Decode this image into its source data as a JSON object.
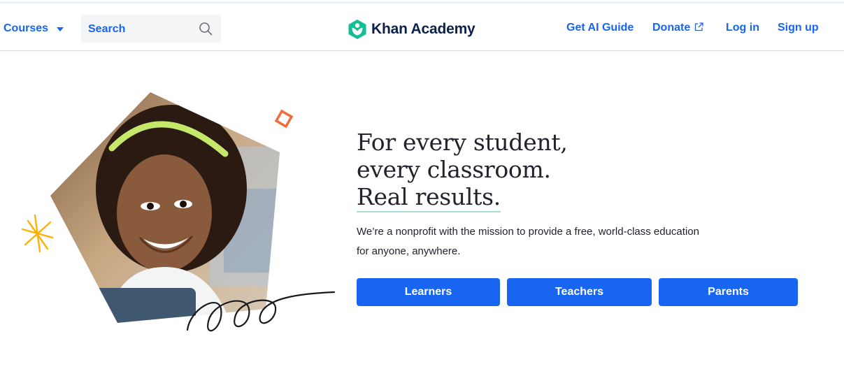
{
  "header": {
    "courses_label": "Courses",
    "search_placeholder": "Search",
    "logo_text": "Khan Academy",
    "links": {
      "ai_guide": "Get AI Guide",
      "donate": "Donate",
      "login": "Log in",
      "signup": "Sign up"
    }
  },
  "hero": {
    "headline_line1": "For every student,",
    "headline_line2": "every classroom.",
    "headline_line3": "Real results.",
    "description_line1": "We’re a nonprofit with the mission to provide a free, world-class education",
    "description_line2": "for anyone, anywhere.",
    "buttons": {
      "learners": "Learners",
      "teachers": "Teachers",
      "parents": "Parents"
    }
  },
  "colors": {
    "brand_blue": "#1865f2",
    "logo_green": "#14bf96",
    "text_dark": "#21242c",
    "accent_orange": "#f26c3b",
    "accent_yellow": "#ffb100"
  },
  "icons": [
    "chevron-down-icon",
    "search-icon",
    "khan-logo-icon",
    "external-link-icon"
  ]
}
